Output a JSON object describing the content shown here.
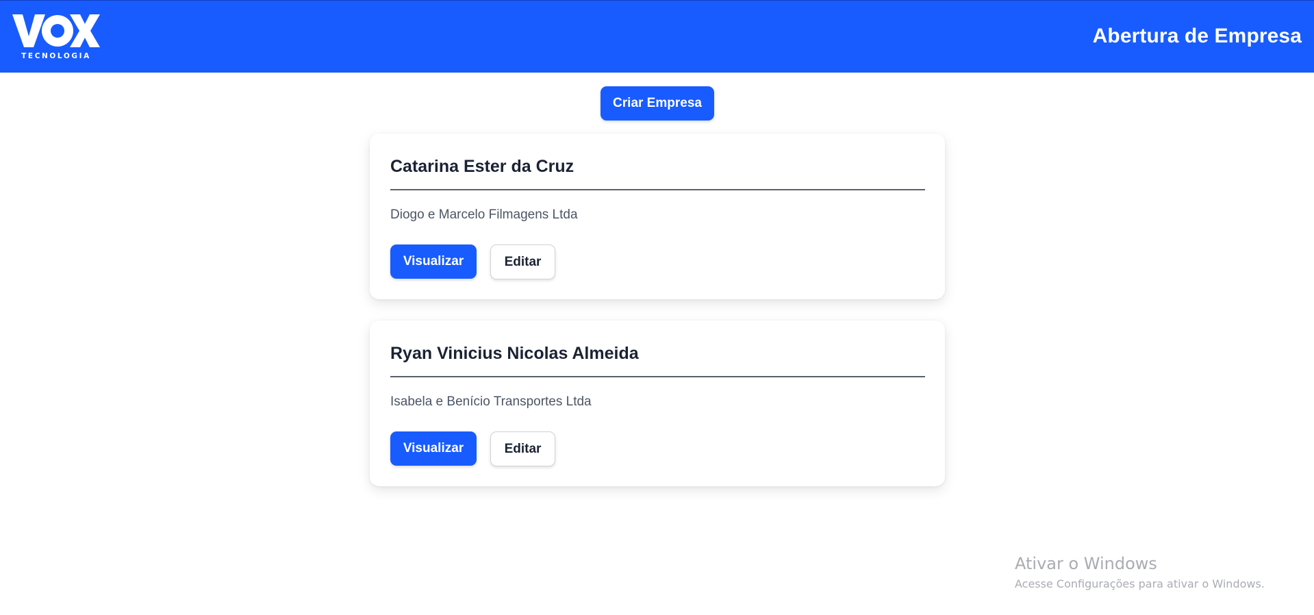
{
  "header": {
    "logo": {
      "brand": "VOX",
      "tagline": "TECNOLOGIA"
    },
    "title": "Abertura de Empresa",
    "background_color": "#185cff"
  },
  "toolbar": {
    "create_label": "Criar Empresa"
  },
  "companies": [
    {
      "owner": "Catarina Ester da Cruz",
      "company": "Diogo e Marcelo Filmagens Ltda",
      "view_label": "Visualizar",
      "edit_label": "Editar"
    },
    {
      "owner": "Ryan Vinicius Nicolas Almeida",
      "company": "Isabela e Benício Transportes Ltda",
      "view_label": "Visualizar",
      "edit_label": "Editar"
    }
  ],
  "watermark": {
    "title": "Ativar o Windows",
    "subtitle": "Acesse Configurações para ativar o Windows."
  },
  "colors": {
    "primary": "#185cff",
    "text_dark": "#1a2233",
    "text_muted": "#4b5565"
  }
}
